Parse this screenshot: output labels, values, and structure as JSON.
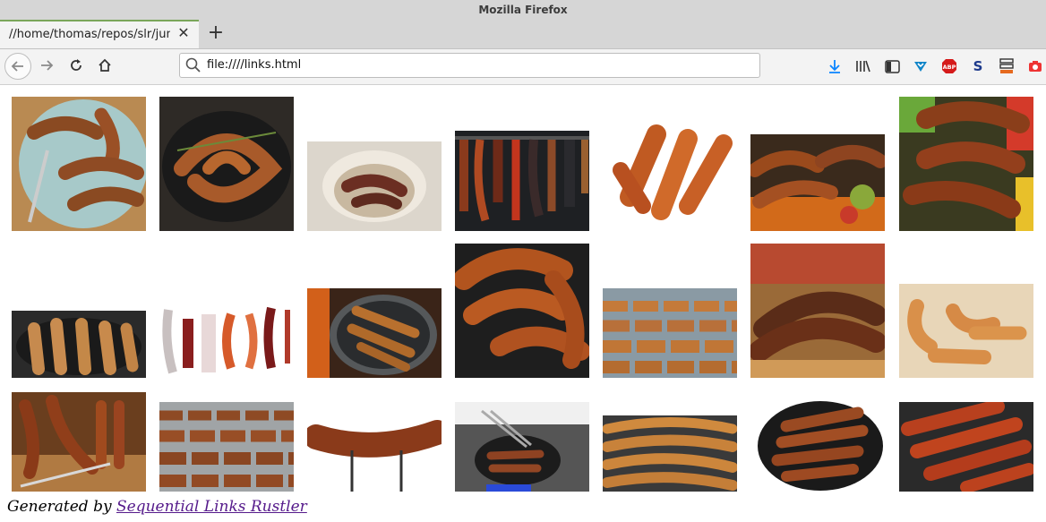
{
  "window": {
    "title": "Mozilla Firefox"
  },
  "tab": {
    "title": "//home/thomas/repos/slr/junk",
    "close_symbol": "✕",
    "new_tab_symbol": "+"
  },
  "nav": {
    "url": "file:////links.html"
  },
  "toolbar_icons": [
    "download-icon",
    "library-icon",
    "sidebar-icon",
    "pocket-icon",
    "adblock-plus-icon",
    "s-extension-icon",
    "bookmarks-manager-icon",
    "screenshot-icon"
  ],
  "toolbar_icon_labels": {
    "abp": "ABP",
    "s": "S"
  },
  "gallery": {
    "images": [
      {
        "name": "sausages-on-plate-with-fork"
      },
      {
        "name": "sausages-in-skillet-with-herbs"
      },
      {
        "name": "sausages-in-bowl"
      },
      {
        "name": "hanging-cured-sausages"
      },
      {
        "name": "grilled-sausages-pile"
      },
      {
        "name": "sausages-on-grill-flames"
      },
      {
        "name": "sausages-with-peppers"
      },
      {
        "name": "sausages-in-pan-with-rosemary"
      },
      {
        "name": "hanging-salami-links"
      },
      {
        "name": "sausages-in-pan-over-fire"
      },
      {
        "name": "sausages-on-dark-board"
      },
      {
        "name": "sausage-rows-on-grill"
      },
      {
        "name": "sausage-in-bun-close-up"
      },
      {
        "name": "hot-dogs-on-wood"
      },
      {
        "name": "sausages-on-cutting-board"
      },
      {
        "name": "sausage-rows-on-grill-2"
      },
      {
        "name": "single-grilled-sausage"
      },
      {
        "name": "sausages-in-pan-with-tongs"
      },
      {
        "name": "sausages-on-grill-grate"
      },
      {
        "name": "sausages-in-black-pan"
      },
      {
        "name": "sausages-on-barbecue"
      }
    ]
  },
  "footer": {
    "prefix": "Generated by",
    "link_text": "Sequential Links Rustler"
  },
  "colors": {
    "accent": "#7aa65a",
    "link": "#551a8b",
    "download": "#0a84ff"
  }
}
